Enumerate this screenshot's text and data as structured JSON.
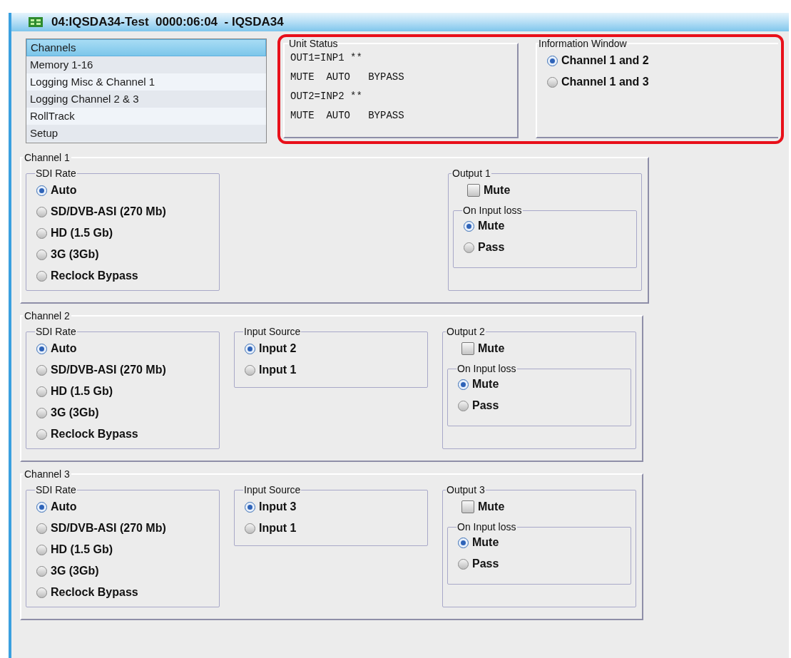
{
  "window": {
    "title": "04:IQSDA34-Test  0000:06:04  - IQSDA34"
  },
  "nav": [
    {
      "label": "Channels",
      "selected": true
    },
    {
      "label": "Memory 1-16",
      "selected": false
    },
    {
      "label": "Logging Misc & Channel 1",
      "selected": false
    },
    {
      "label": "Logging Channel 2 & 3",
      "selected": false
    },
    {
      "label": "RollTrack",
      "selected": false
    },
    {
      "label": "Setup",
      "selected": false
    }
  ],
  "unit_status": {
    "title": "Unit Status",
    "lines": [
      "OUT1=INP1 **",
      "MUTE  AUTO   BYPASS",
      "OUT2=INP2 **",
      "MUTE  AUTO   BYPASS"
    ]
  },
  "information_window": {
    "title": "Information Window",
    "options": [
      {
        "label": "Channel 1 and 2",
        "selected": true
      },
      {
        "label": "Channel 1 and 3",
        "selected": false
      }
    ]
  },
  "channels": [
    {
      "title": "Channel 1",
      "sdi_rate": {
        "title": "SDI Rate",
        "options": [
          {
            "label": "Auto",
            "selected": true
          },
          {
            "label": "SD/DVB-ASI (270 Mb)",
            "selected": false
          },
          {
            "label": "HD (1.5 Gb)",
            "selected": false
          },
          {
            "label": "3G (3Gb)",
            "selected": false
          },
          {
            "label": "Reclock Bypass",
            "selected": false
          }
        ]
      },
      "output": {
        "title": "Output 1",
        "mute": {
          "label": "Mute",
          "checked": false
        },
        "on_input_loss": {
          "title": "On Input loss",
          "options": [
            {
              "label": "Mute",
              "selected": true
            },
            {
              "label": "Pass",
              "selected": false
            }
          ]
        }
      }
    },
    {
      "title": "Channel 2",
      "sdi_rate": {
        "title": "SDI Rate",
        "options": [
          {
            "label": "Auto",
            "selected": true
          },
          {
            "label": "SD/DVB-ASI (270 Mb)",
            "selected": false
          },
          {
            "label": "HD (1.5 Gb)",
            "selected": false
          },
          {
            "label": "3G (3Gb)",
            "selected": false
          },
          {
            "label": "Reclock Bypass",
            "selected": false
          }
        ]
      },
      "input_source": {
        "title": "Input Source",
        "options": [
          {
            "label": "Input 2",
            "selected": true
          },
          {
            "label": "Input 1",
            "selected": false
          }
        ]
      },
      "output": {
        "title": "Output 2",
        "mute": {
          "label": "Mute",
          "checked": false
        },
        "on_input_loss": {
          "title": "On Input loss",
          "options": [
            {
              "label": "Mute",
              "selected": true
            },
            {
              "label": "Pass",
              "selected": false
            }
          ]
        }
      }
    },
    {
      "title": "Channel 3",
      "sdi_rate": {
        "title": "SDI Rate",
        "options": [
          {
            "label": "Auto",
            "selected": true
          },
          {
            "label": "SD/DVB-ASI (270 Mb)",
            "selected": false
          },
          {
            "label": "HD (1.5 Gb)",
            "selected": false
          },
          {
            "label": "3G (3Gb)",
            "selected": false
          },
          {
            "label": "Reclock Bypass",
            "selected": false
          }
        ]
      },
      "input_source": {
        "title": "Input Source",
        "options": [
          {
            "label": "Input 3",
            "selected": true
          },
          {
            "label": "Input 1",
            "selected": false
          }
        ]
      },
      "output": {
        "title": "Output 3",
        "mute": {
          "label": "Mute",
          "checked": false
        },
        "on_input_loss": {
          "title": "On Input loss",
          "options": [
            {
              "label": "Mute",
              "selected": true
            },
            {
              "label": "Pass",
              "selected": false
            }
          ]
        }
      }
    }
  ]
}
